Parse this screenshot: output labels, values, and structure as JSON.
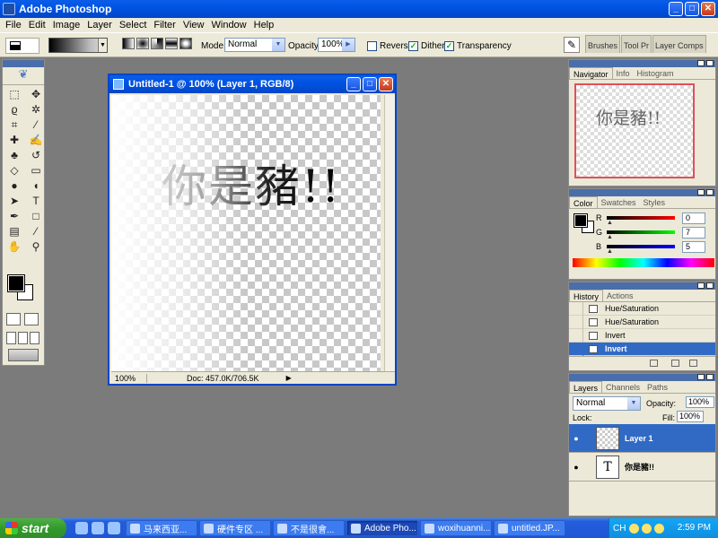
{
  "app": {
    "title": "Adobe Photoshop",
    "window_buttons": [
      "_",
      "□",
      "✕"
    ]
  },
  "menu": [
    "File",
    "Edit",
    "Image",
    "Layer",
    "Select",
    "Filter",
    "View",
    "Window",
    "Help"
  ],
  "options": {
    "mode_label": "Mode:",
    "mode_value": "Normal",
    "opacity_label": "Opacity:",
    "opacity_value": "100%",
    "reverse_label": "Reverse",
    "reverse_checked": false,
    "dither_label": "Dither",
    "dither_checked": true,
    "transparency_label": "Transparency",
    "transparency_checked": true,
    "palette_well": [
      "Brushes",
      "Tool Pr",
      "Layer Comps"
    ]
  },
  "document": {
    "title": "Untitled-1 @ 100% (Layer 1, RGB/8)",
    "canvas_text": "你是豬!!",
    "zoom": "100%",
    "doc_size": "Doc: 457.0K/706.5K"
  },
  "navigator": {
    "tabs": [
      "Navigator",
      "Info",
      "Histogram"
    ],
    "active_tab": "Navigator",
    "preview_text": "你是豬!!"
  },
  "color": {
    "tabs": [
      "Color",
      "Swatches",
      "Styles"
    ],
    "active_tab": "Color",
    "r_label": "R",
    "r_value": "0",
    "g_label": "G",
    "g_value": "7",
    "b_label": "B",
    "b_value": "5"
  },
  "history": {
    "tabs": [
      "History",
      "Actions"
    ],
    "active_tab": "History",
    "items": [
      "Hue/Saturation",
      "Hue/Saturation",
      "Invert",
      "Invert"
    ],
    "selected_index": 3
  },
  "layers": {
    "tabs": [
      "Layers",
      "Channels",
      "Paths"
    ],
    "active_tab": "Layers",
    "blend_mode": "Normal",
    "opacity_label": "Opacity:",
    "opacity_value": "100%",
    "lock_label": "Lock:",
    "fill_label": "Fill:",
    "fill_value": "100%",
    "items": [
      {
        "name": "Layer 1",
        "type": "raster",
        "selected": true
      },
      {
        "name": "你是豬!!",
        "type": "text",
        "selected": false
      }
    ]
  },
  "taskbar": {
    "start_label": "start",
    "tasks": [
      "马来西亚...",
      "硬件专区 ...",
      "不是很會...",
      "Adobe Pho...",
      "woxihuanni...",
      "untitled.JP..."
    ],
    "active_task_index": 3,
    "lang": "CH",
    "clock": "2:59 PM"
  },
  "colors": {
    "xp_blue": "#0054e3",
    "selection": "#316ac5",
    "workspace": "#7b7b7b",
    "chrome": "#ece9d8"
  }
}
